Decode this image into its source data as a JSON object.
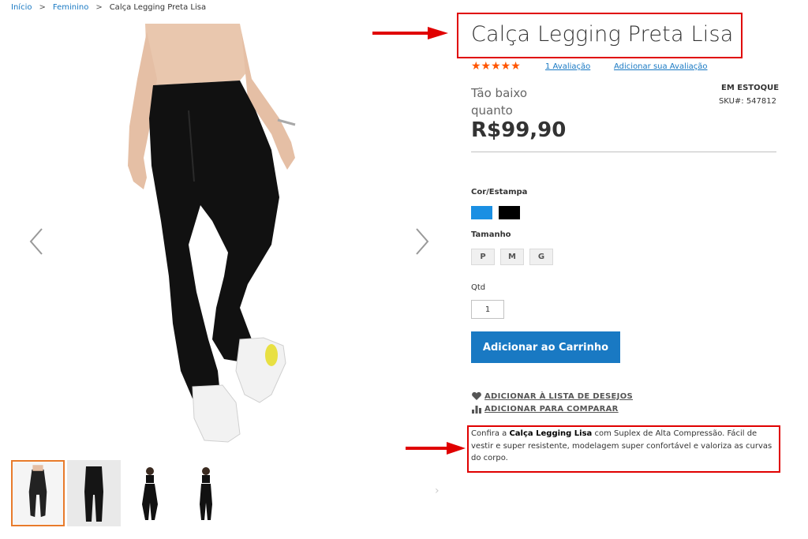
{
  "breadcrumb": {
    "home": "Início",
    "category": "Feminino",
    "current": "Calça Legging Preta Lisa",
    "separator": ">"
  },
  "product": {
    "title": "Calça Legging Preta Lisa",
    "stars": "★★★★★",
    "rating_value": 5,
    "rating_max": 5,
    "reviews_link": "1  Avaliação",
    "add_review_link": "Adicionar sua Avaliação",
    "price_label": "Tão baixo quanto",
    "price": "R$99,90",
    "stock": "EM ESTOQUE",
    "sku": "SKU#:  547812"
  },
  "options": {
    "color_label": "Cor/Estampa",
    "colors": [
      "#1a8fe3",
      "#000000"
    ],
    "size_label": "Tamanho",
    "sizes": [
      "P",
      "M",
      "G"
    ]
  },
  "qty": {
    "label": "Qtd",
    "value": "1"
  },
  "actions": {
    "add_to_cart": "Adicionar ao Carrinho",
    "wishlist": "ADICIONAR À LISTA DE DESEJOS",
    "compare": "ADICIONAR PARA COMPARAR"
  },
  "description": {
    "prefix": "Confira a ",
    "product_name": "Calça Legging Lisa",
    "text": " com Suplex de Alta Compressão. Fácil de vestir e super resistente, modelagem super confortável e valoriza as curvas do corpo."
  },
  "gallery": {
    "prev_icon": "chevron-left-icon",
    "next_icon": "chevron-right-icon",
    "thumb_count": 4,
    "active_thumb": 1
  },
  "colors": {
    "accent": "#1979c3",
    "stars": "#ff5501",
    "annotation": "#e00000",
    "active_thumb_border": "#e87b2b"
  }
}
